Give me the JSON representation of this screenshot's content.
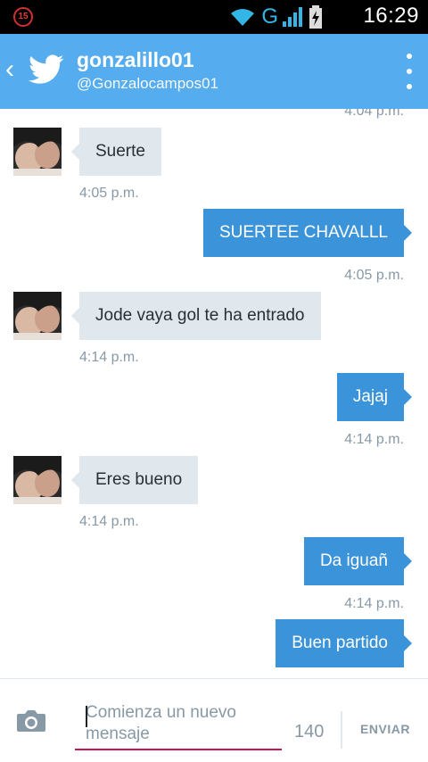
{
  "statusbar": {
    "notification_count": "15",
    "network_type": "G",
    "time": "16:29"
  },
  "header": {
    "display_name": "gonzalillo01",
    "handle": "@Gonzalocampos01",
    "icons": {
      "back": "back-chevron-icon",
      "logo": "twitter-bird-icon",
      "menu": "overflow-menu-icon"
    },
    "accent_color": "#55acee"
  },
  "conversation": {
    "top_timestamp": "4:04 p.m.",
    "messages": [
      {
        "direction": "in",
        "text": "Suerte",
        "time": "4:05 p.m."
      },
      {
        "direction": "out",
        "text": "SUERTEE CHAVALLL",
        "time": "4:05 p.m."
      },
      {
        "direction": "in",
        "text": "Jode vaya gol te ha entrado",
        "time": "4:14 p.m."
      },
      {
        "direction": "out",
        "text": "Jajaj",
        "time": "4:14 p.m."
      },
      {
        "direction": "in",
        "text": "Eres bueno",
        "time": "4:14 p.m."
      },
      {
        "direction": "out",
        "text": "Da iguañ",
        "time": "4:14 p.m."
      },
      {
        "direction": "out",
        "text": "Buen partido",
        "time": ""
      }
    ],
    "colors": {
      "incoming_bubble": "#e1e8ed",
      "outgoing_bubble": "#3b94d9",
      "timestamp": "#8899a6"
    }
  },
  "composer": {
    "placeholder": "Comienza un nuevo mensaje",
    "value": "",
    "char_count": "140",
    "send_label": "ENVIAR",
    "icons": {
      "camera": "camera-icon"
    }
  }
}
